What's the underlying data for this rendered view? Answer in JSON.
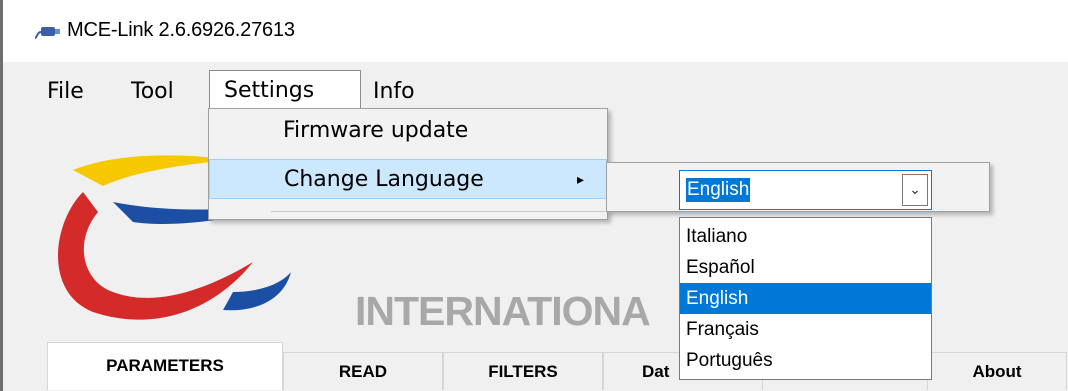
{
  "window": {
    "title": "MCE-Link 2.6.6926.27613",
    "app_icon": "cable-connector-icon"
  },
  "menubar": {
    "file": "File",
    "tool": "Tool",
    "settings": "Settings",
    "info": "Info"
  },
  "settings_menu": {
    "items": [
      {
        "label": "Firmware update"
      },
      {
        "label": "Change Language",
        "submenu_arrow": "▸"
      }
    ]
  },
  "language": {
    "current": "English",
    "options": [
      "Italiano",
      "Español",
      "English",
      "Français",
      "Português"
    ],
    "selected_index": 2
  },
  "brand": {
    "text": "INTERNATIONA"
  },
  "tabs": [
    "PARAMETERS",
    "READ",
    "FILTERS",
    "Dat",
    "About"
  ],
  "colors": {
    "accent": "#0078d7",
    "highlight": "#cce8ff"
  }
}
